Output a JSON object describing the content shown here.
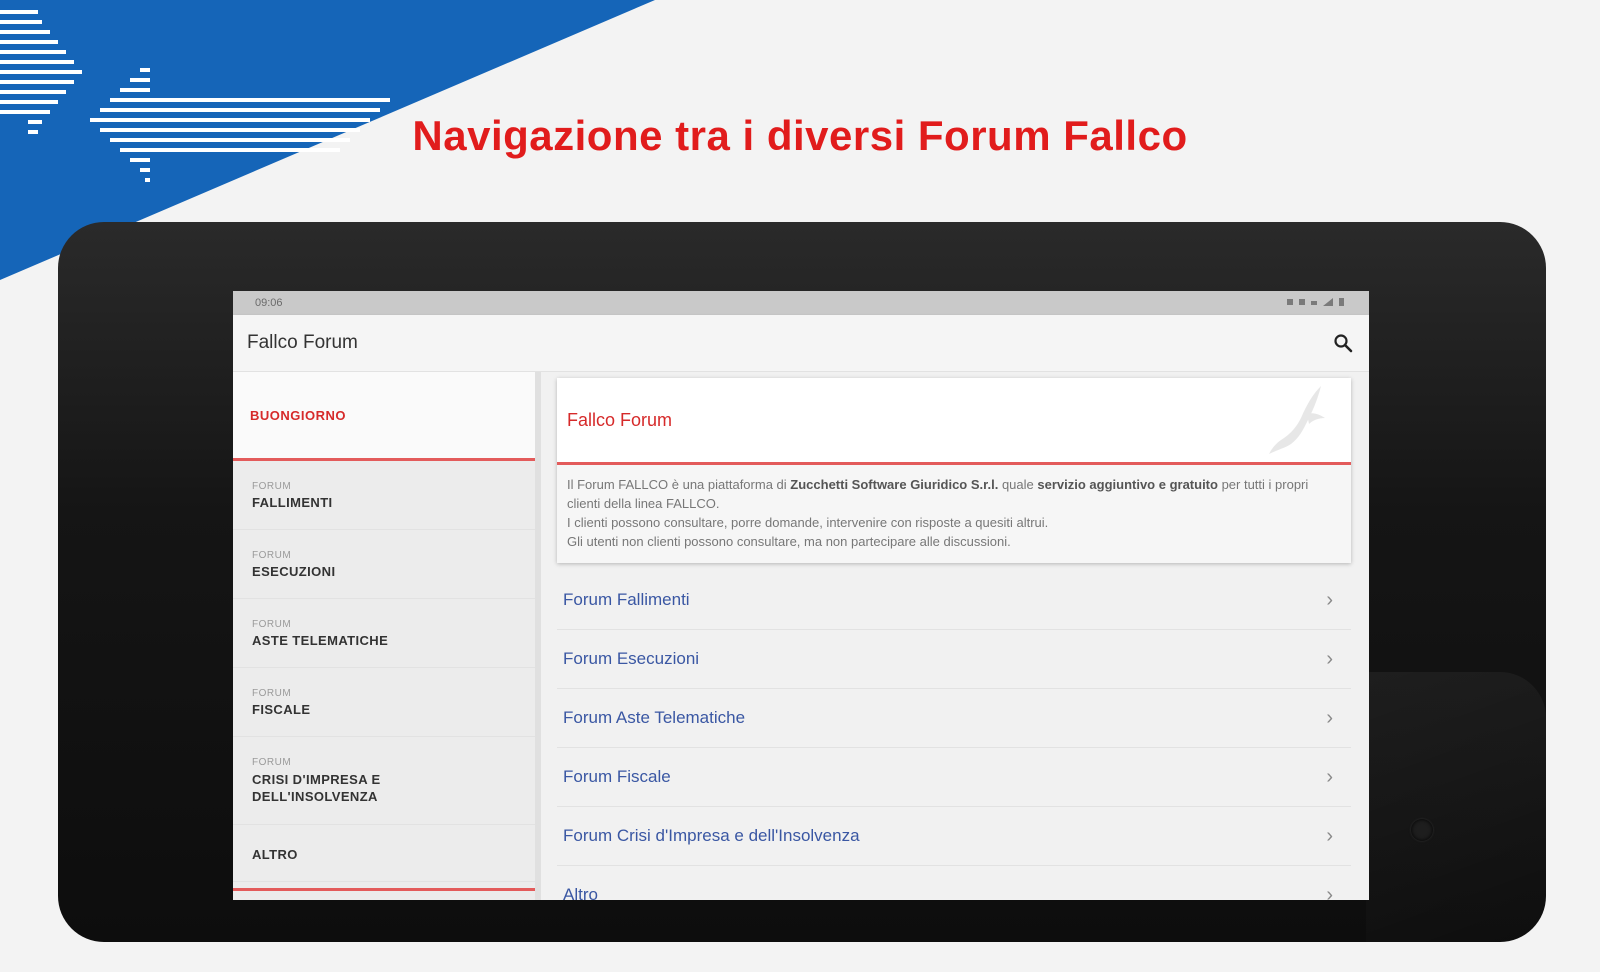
{
  "headline": "Navigazione tra i diversi Forum Fallco",
  "colors": {
    "brand_blue": "#1565b8",
    "accent_red": "#e11c1c",
    "link_blue": "#3a57a3"
  },
  "statusbar": {
    "time": "09:06"
  },
  "app": {
    "title": "Fallco Forum",
    "search_icon": "search-icon"
  },
  "sidebar": {
    "greeting": "BUONGIORNO",
    "items": [
      {
        "kicker": "FORUM",
        "label": "FALLIMENTI"
      },
      {
        "kicker": "FORUM",
        "label": "ESECUZIONI"
      },
      {
        "kicker": "FORUM",
        "label": "ASTE TELEMATICHE"
      },
      {
        "kicker": "FORUM",
        "label": "FISCALE"
      },
      {
        "kicker": "FORUM",
        "label": "CRISI D'IMPRESA E DELL'INSOLVENZA"
      },
      {
        "kicker": "",
        "label": "ALTRO"
      }
    ]
  },
  "intro": {
    "title": "Fallco Forum",
    "p1_a": "Il Forum FALLCO è una piattaforma di ",
    "p1_b": "Zucchetti Software Giuridico S.r.l.",
    "p1_c": " quale ",
    "p1_d": "servizio aggiuntivo e gratuito",
    "p1_e": " per tutti i propri clienti della linea FALLCO.",
    "p2": "I clienti possono consultare, porre domande, intervenire con risposte a quesiti altrui.",
    "p3": "Gli utenti non clienti possono consultare, ma non partecipare alle discussioni."
  },
  "forums": [
    "Forum Fallimenti",
    "Forum Esecuzioni",
    "Forum Aste Telematiche",
    "Forum Fiscale",
    "Forum Crisi d'Impresa e dell'Insolvenza",
    "Altro"
  ]
}
